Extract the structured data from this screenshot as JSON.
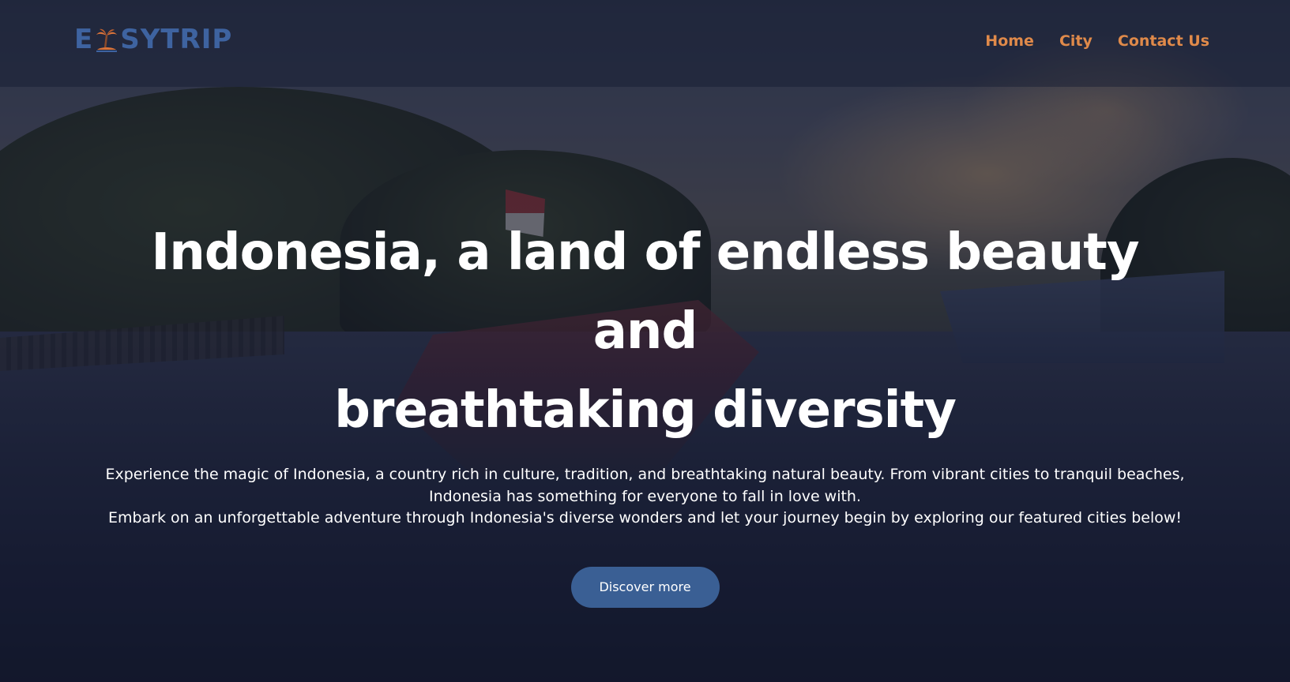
{
  "header": {
    "logo": {
      "prefix": "E",
      "suffix": "SYTRIP",
      "icon": "palm-island-icon"
    },
    "nav": [
      {
        "label": "Home"
      },
      {
        "label": "City"
      },
      {
        "label": "Contact Us"
      }
    ]
  },
  "hero": {
    "title_line1": "Indonesia, a land of endless beauty and",
    "title_line2": "breathtaking diversity",
    "desc_line1": "Experience the magic of Indonesia, a country rich in culture, tradition, and breathtaking natural beauty. From vibrant cities to tranquil beaches, Indonesia has something for everyone to fall in love with.",
    "desc_line2": "Embark on an unforgettable adventure through Indonesia's diverse wonders and let your journey begin by exploring our featured cities below!",
    "cta_label": "Discover more"
  },
  "colors": {
    "brand_blue": "#3e63a0",
    "nav_orange": "#e08a4a",
    "button_blue": "#3a5f94",
    "text_white": "#ffffff"
  }
}
